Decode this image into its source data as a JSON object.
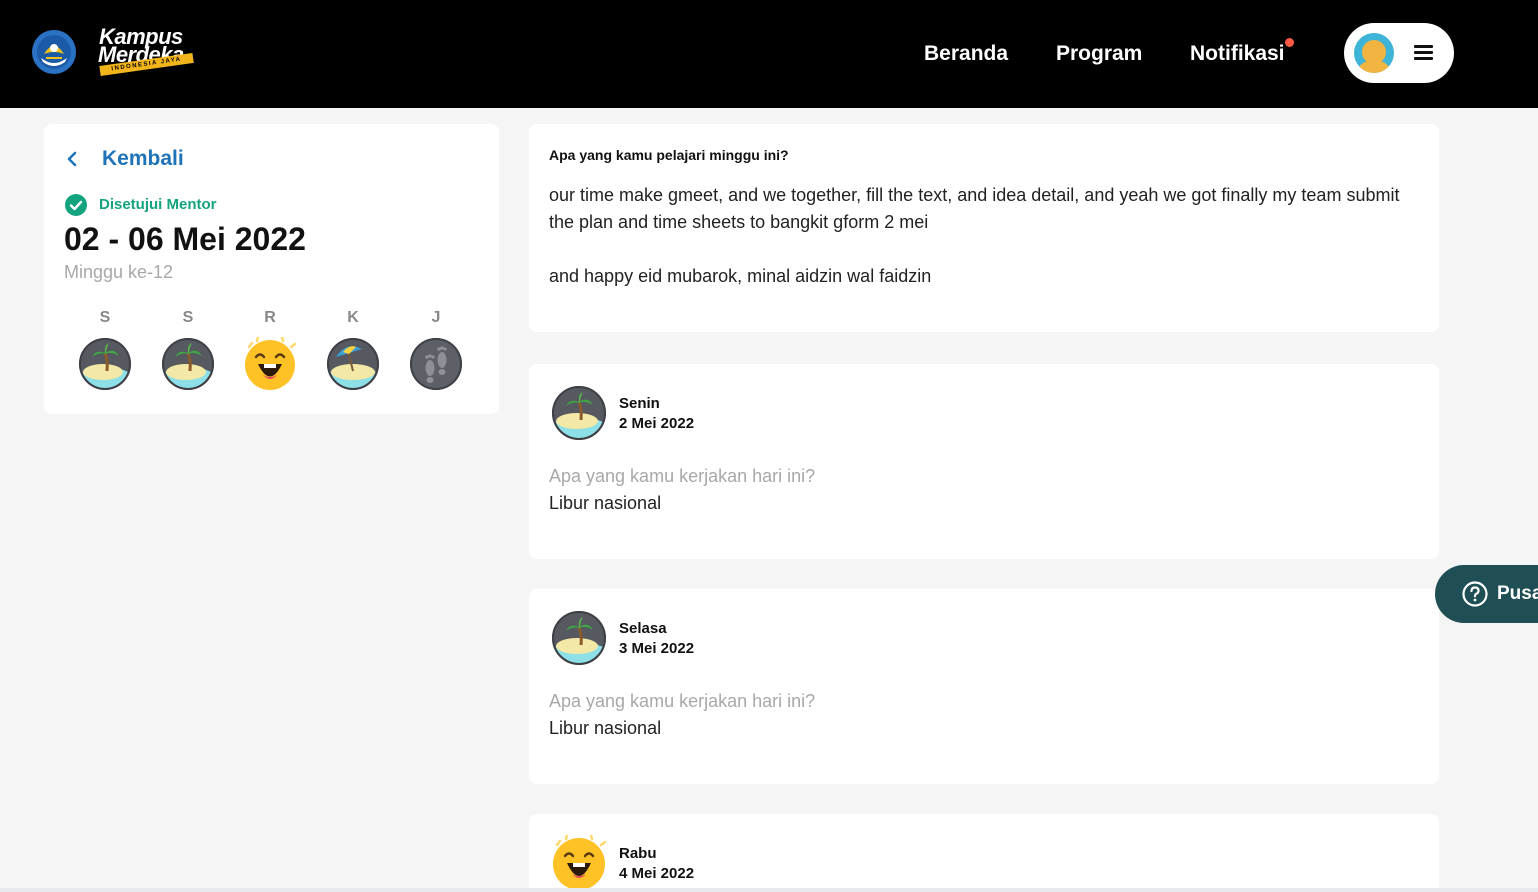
{
  "header": {
    "brand_line1": "Kampus",
    "brand_line2": "Merdeka",
    "brand_tagline": "INDONESIA JAYA",
    "nav": [
      {
        "label": "Beranda",
        "icon": null
      },
      {
        "label": "Program",
        "icon": null
      },
      {
        "label": "Notifikasi",
        "icon": "notification-dot-icon"
      }
    ],
    "notification_dot_color": "#ff5a43",
    "user_menu_icon": "hamburger-menu-icon",
    "avatar_icon": "user-avatar-icon"
  },
  "sidebar": {
    "back_label": "Kembali",
    "status_label": "Disetujui Mentor",
    "status_color": "#14a37f",
    "week_title": "02 - 06 Mei 2022",
    "week_subtitle": "Minggu ke-12",
    "days": [
      {
        "letter": "S",
        "icon": "beach-island-icon"
      },
      {
        "letter": "S",
        "icon": "beach-island-icon"
      },
      {
        "letter": "R",
        "icon": "happy-face-icon"
      },
      {
        "letter": "K",
        "icon": "beach-umbrella-icon"
      },
      {
        "letter": "J",
        "icon": "footprints-icon"
      }
    ]
  },
  "learning": {
    "question": "Apa yang kamu pelajari minggu ini?",
    "answer": "our time make gmeet, and we together, fill the text, and idea detail, and yeah we got finally my team submit the plan and time sheets to bangkit gform 2 mei\n\nand happy eid mubarok, minal aidzin wal faidzin"
  },
  "daily_entries": [
    {
      "day": "Senin",
      "date": "2 Mei 2022",
      "icon": "beach-island-icon",
      "question": "Apa yang kamu kerjakan hari ini?",
      "answer": "Libur nasional"
    },
    {
      "day": "Selasa",
      "date": "3 Mei 2022",
      "icon": "beach-island-icon",
      "question": "Apa yang kamu kerjakan hari ini?",
      "answer": "Libur nasional"
    },
    {
      "day": "Rabu",
      "date": "4 Mei 2022",
      "icon": "happy-face-icon"
    }
  ],
  "help_button": {
    "label": "Pusat",
    "icon": "question-circle-icon"
  },
  "colors": {
    "accent_blue": "#1f73b7",
    "help_bg": "#1f4f55",
    "header_bg": "#000000"
  }
}
